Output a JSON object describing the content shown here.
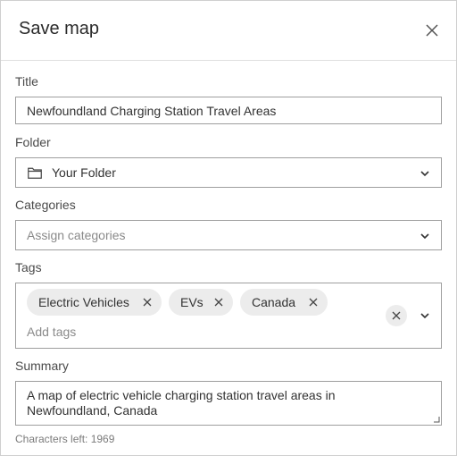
{
  "dialog": {
    "title": "Save map",
    "close_icon": "close-icon"
  },
  "form": {
    "title_label": "Title",
    "title_value": "Newfoundland Charging Station Travel Areas",
    "folder_label": "Folder",
    "folder_value": "Your Folder",
    "folder_icon": "folder-icon",
    "categories_label": "Categories",
    "categories_placeholder": "Assign categories",
    "tags_label": "Tags",
    "tags": [
      "Electric Vehicles",
      "EVs",
      "Canada"
    ],
    "tags_placeholder": "Add tags",
    "summary_label": "Summary",
    "summary_line1": "A map of electric vehicle charging station travel areas in",
    "summary_line2": "Newfoundland, Canada",
    "characters_left": "Characters left: 1969"
  },
  "colors": {
    "border": "#9e9e9e",
    "chip_bg": "#ececec",
    "text": "#323232"
  }
}
